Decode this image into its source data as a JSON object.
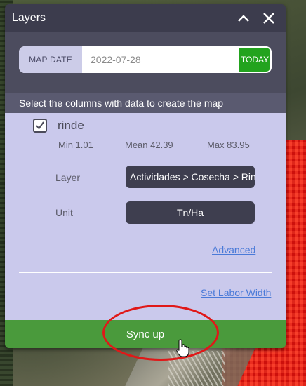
{
  "panel": {
    "title": "Layers",
    "collapse_icon": "chevron-up-icon",
    "close_icon": "close-icon"
  },
  "map_date": {
    "label": "MAP DATE",
    "value": "2022-07-28",
    "today_label": "TODAY"
  },
  "instructions": "Select the columns with data to create the map",
  "column": {
    "checked": true,
    "name": "rinde",
    "min": "Min 1.01",
    "mean": "Mean 42.39",
    "max": "Max 83.95"
  },
  "layer": {
    "label": "Layer",
    "value": "Actividades > Cosecha > Rinde"
  },
  "unit": {
    "label": "Unit",
    "value": "Tn/Ha"
  },
  "links": {
    "advanced": "Advanced",
    "set_labor_width": "Set Labor Width"
  },
  "sync_label": "Sync up",
  "colors": {
    "panel_header": "#3c3c4d",
    "panel_body": "#cac9ec",
    "today_green": "#23a31e",
    "sync_green": "#4a9a3c",
    "annotation_red": "#e01818",
    "link_blue": "#4a7ad8"
  }
}
